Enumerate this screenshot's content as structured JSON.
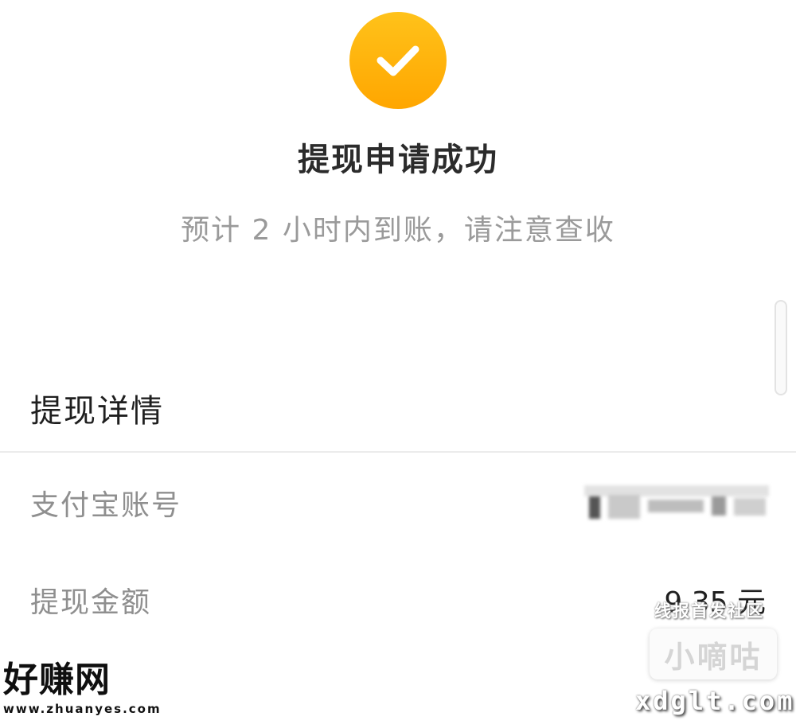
{
  "status": {
    "icon": "check-icon",
    "accent_color": "#ffb000",
    "title": "提现申请成功",
    "subtitle": "预计 2 小时内到账，请注意查收"
  },
  "details": {
    "section_title": "提现详情",
    "rows": [
      {
        "label": "支付宝账号",
        "value": ""
      },
      {
        "label": "提现金额",
        "value": "9.35 元"
      }
    ]
  },
  "watermarks": {
    "left_logo": "好赚网",
    "left_url": "www.zhuanyes.com",
    "right_tag": "线报首发社区",
    "right_box": "小嘀咕",
    "right_domain": "xdglt.com"
  }
}
